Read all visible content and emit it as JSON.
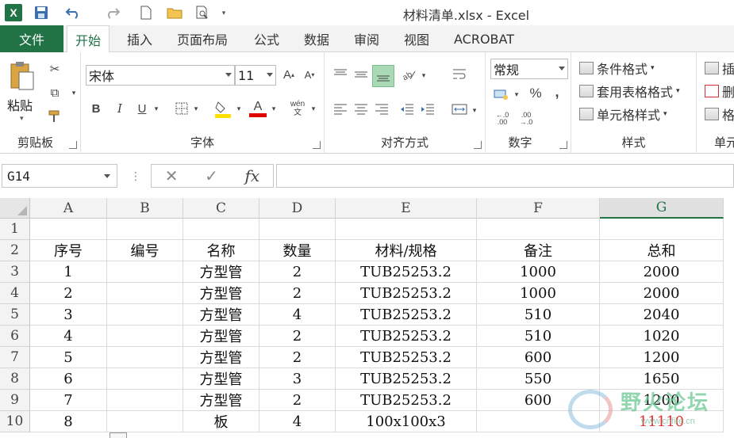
{
  "window": {
    "title": "材料清单.xlsx - Excel",
    "logo": "X"
  },
  "tabs": {
    "file": "文件",
    "items": [
      "开始",
      "插入",
      "页面布局",
      "公式",
      "数据",
      "审阅",
      "视图",
      "ACROBAT"
    ],
    "active": "开始"
  },
  "ribbon": {
    "clipboard": {
      "paste": "粘贴",
      "label": "剪贴板"
    },
    "font": {
      "name": "宋体",
      "size": "11",
      "label": "字体",
      "bold": "B",
      "italic": "I",
      "underline": "U",
      "grow": "A",
      "shrink": "A",
      "phonetic": "wén 文",
      "font_color_letter": "A"
    },
    "alignment": {
      "label": "对齐方式"
    },
    "number": {
      "format": "常规",
      "percent": "%",
      "comma": ",",
      "inc_decimal": "←.0 .00",
      "dec_decimal": ".00 →.0",
      "label": "数字"
    },
    "styles": {
      "conditional": "条件格式",
      "table": "套用表格格式",
      "cell": "单元格样式",
      "label": "样式"
    },
    "cells": {
      "insert": "插",
      "delete": "删",
      "format": "格",
      "label": "单元"
    }
  },
  "formula_bar": {
    "name_box": "G14",
    "cancel": "✕",
    "enter": "✓",
    "fx": "fx",
    "value": ""
  },
  "sheet": {
    "columns": [
      "A",
      "B",
      "C",
      "D",
      "E",
      "F",
      "G"
    ],
    "selected_column": "G",
    "rows": [
      {
        "num": "1",
        "cells": [
          "",
          "",
          "",
          "",
          "",
          "",
          ""
        ]
      },
      {
        "num": "2",
        "cells": [
          "序号",
          "编号",
          "名称",
          "数量",
          "材料/规格",
          "备注",
          "总和"
        ]
      },
      {
        "num": "3",
        "cells": [
          "1",
          "",
          "方型管",
          "2",
          "TUB25253.2",
          "1000",
          "2000"
        ]
      },
      {
        "num": "4",
        "cells": [
          "2",
          "",
          "方型管",
          "2",
          "TUB25253.2",
          "1000",
          "2000"
        ]
      },
      {
        "num": "5",
        "cells": [
          "3",
          "",
          "方型管",
          "4",
          "TUB25253.2",
          "510",
          "2040"
        ]
      },
      {
        "num": "6",
        "cells": [
          "4",
          "",
          "方型管",
          "2",
          "TUB25253.2",
          "510",
          "1020"
        ]
      },
      {
        "num": "7",
        "cells": [
          "5",
          "",
          "方型管",
          "2",
          "TUB25253.2",
          "600",
          "1200"
        ]
      },
      {
        "num": "8",
        "cells": [
          "6",
          "",
          "方型管",
          "3",
          "TUB25253.2",
          "550",
          "1650"
        ]
      },
      {
        "num": "9",
        "cells": [
          "7",
          "",
          "方型管",
          "2",
          "TUB25253.2",
          "600",
          "1200"
        ]
      },
      {
        "num": "10",
        "cells": [
          "8",
          "",
          "板",
          "4",
          "100x100x3",
          "",
          "11110"
        ]
      }
    ],
    "highlight_cell_color": "#e03030"
  },
  "watermark": {
    "text": "野火论坛",
    "sub": "www.cnfire.cn"
  },
  "colors": {
    "accent": "#217346"
  }
}
